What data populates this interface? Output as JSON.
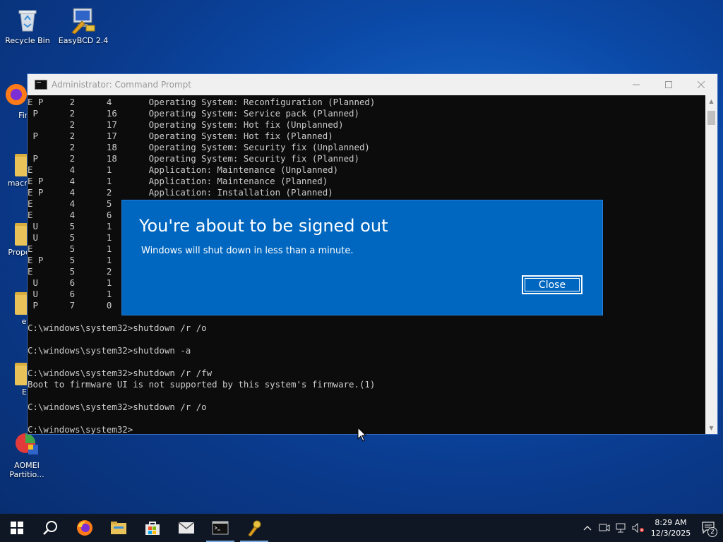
{
  "desktop": {
    "icons": [
      {
        "label": "Recycle Bin",
        "icon": "recycle-bin-icon"
      },
      {
        "label": "EasyBCD 2.4",
        "icon": "easybcd-icon"
      },
      {
        "label": "Fire",
        "icon": "firefox-icon"
      },
      {
        "label": "macre",
        "icon": "folder-icon"
      },
      {
        "label": "Prope",
        "icon": "folder-icon"
      },
      {
        "label": "ef",
        "icon": "folder-icon"
      },
      {
        "label": "El",
        "icon": "folder-icon"
      },
      {
        "label": "AOMEI Partitio...",
        "icon": "aomei-partition-icon"
      }
    ]
  },
  "cmd": {
    "title": "Administrator: Command Prompt",
    "lines": [
      "E P     2      4       Operating System: Reconfiguration (Planned)",
      " P      2      16      Operating System: Service pack (Planned)",
      "        2      17      Operating System: Hot fix (Unplanned)",
      " P      2      17      Operating System: Hot fix (Planned)",
      "        2      18      Operating System: Security fix (Unplanned)",
      " P      2      18      Operating System: Security fix (Planned)",
      "E       4      1       Application: Maintenance (Unplanned)",
      "E P     4      1       Application: Maintenance (Planned)",
      "E P     4      2       Application: Installation (Planned)",
      "E       4      5",
      "E       4      6",
      " U      5      1",
      " U      5      1",
      "E       5      1",
      "E P     5      1",
      "E       5      2",
      " U      6      1",
      " U      6      1",
      " P      7      0",
      "",
      "C:\\windows\\system32>shutdown /r /o",
      "",
      "C:\\windows\\system32>shutdown -a",
      "",
      "C:\\windows\\system32>shutdown /r /fw",
      "Boot to firmware UI is not supported by this system's firmware.(1)",
      "",
      "C:\\windows\\system32>shutdown /r /o",
      "",
      "C:\\windows\\system32>"
    ]
  },
  "dialog": {
    "heading": "You're about to be signed out",
    "message": "Windows will shut down in less than a minute.",
    "close_label": "Close"
  },
  "taskbar": {
    "items": [
      {
        "name": "start-button",
        "icon": "windows-logo-icon"
      },
      {
        "name": "search-button",
        "icon": "search-icon"
      },
      {
        "name": "firefox-taskbar",
        "icon": "firefox-icon"
      },
      {
        "name": "file-explorer-taskbar",
        "icon": "folder-icon"
      },
      {
        "name": "store-taskbar",
        "icon": "store-icon"
      },
      {
        "name": "mail-taskbar",
        "icon": "mail-icon"
      },
      {
        "name": "cmd-taskbar",
        "icon": "terminal-icon"
      },
      {
        "name": "easybcd-taskbar",
        "icon": "easybcd-icon"
      }
    ],
    "clock_time": "8:29 AM",
    "clock_date": "12/3/2025",
    "notification_count": "2"
  },
  "colors": {
    "dialog_bg": "#0067c0",
    "cmd_bg": "#0c0c0c",
    "cmd_text": "#cccccc",
    "taskbar_bg": "#0f1724"
  }
}
